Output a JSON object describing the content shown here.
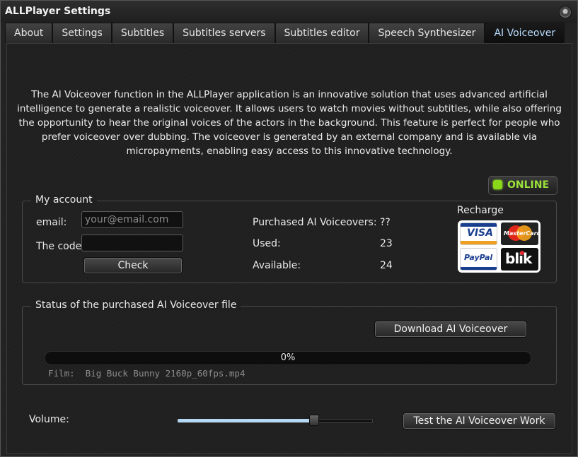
{
  "window": {
    "title": "ALLPlayer Settings"
  },
  "tabs": [
    {
      "label": "About"
    },
    {
      "label": "Settings"
    },
    {
      "label": "Subtitles"
    },
    {
      "label": "Subtitles servers"
    },
    {
      "label": "Subtitles editor"
    },
    {
      "label": "Speech Synthesizer"
    },
    {
      "label": "AI Voiceover",
      "active": true
    }
  ],
  "description": "The AI Voiceover function in the ALLPlayer application is an innovative solution that uses advanced artificial intelligence to generate a realistic voiceover. It allows users to watch movies without subtitles, while also offering the opportunity to hear the original voices of the actors in the background. This feature is perfect for people who prefer voiceover over dubbing. The voiceover is generated by an external company and is available via micropayments, enabling easy access to this innovative technology.",
  "status": {
    "label": "ONLINE",
    "color": "#8ad81a"
  },
  "account": {
    "legend": "My account",
    "email_label": "email:",
    "email_placeholder": "your@email.com",
    "email_value": "",
    "code_label": "The code:",
    "code_value": "",
    "check_button": "Check",
    "purchased_label": "Purchased AI Voiceovers:",
    "purchased_value": "??",
    "used_label": "Used:",
    "used_value": "23",
    "available_label": "Available:",
    "available_value": "24",
    "recharge_label": "Recharge",
    "payment_methods": [
      "VISA",
      "MasterCard",
      "PayPal",
      "blik"
    ]
  },
  "file_status": {
    "legend": "Status of the purchased AI Voiceover file",
    "download_button": "Download AI Voiceover",
    "progress_percent": 0,
    "progress_label": "0%",
    "film_label": "Film:",
    "film_name": "Big Buck Bunny 2160p_60fps.mp4"
  },
  "volume": {
    "label": "Volume:",
    "level": 0.71
  },
  "test_button": "Test the AI Voiceover Work",
  "colors": {
    "accent": "#b9dcff",
    "online_text": "#9be23a"
  }
}
